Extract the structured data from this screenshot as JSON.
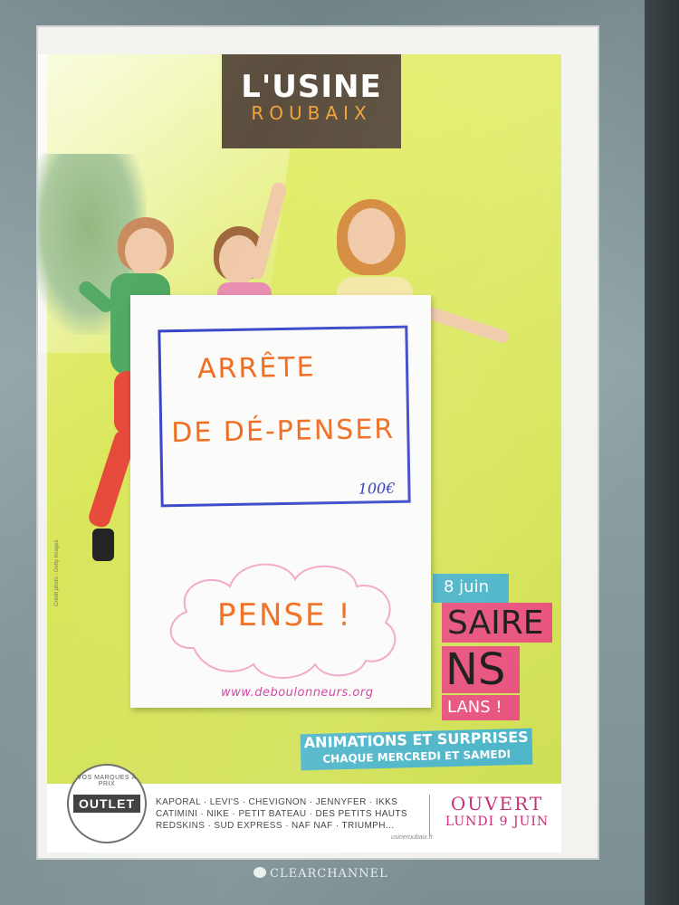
{
  "poster": {
    "logo_main": "L'USINE",
    "logo_sub": "ROUBAIX",
    "photo_credit": "Crédit photo : Getty Images",
    "tags": {
      "date": "8 juin",
      "anniversaire_fragment": "SAIRE",
      "ans_fragment": "NS",
      "ans_line2_fragment": "LANS !",
      "animations": "ANIMATIONS ET SURPRISES",
      "days": "CHAQUE MERCREDI ET SAMEDI"
    },
    "footer": {
      "badge_arc": "VOS MARQUES À PRIX",
      "badge_main": "OUTLET",
      "brands_line1": "KAPORAL · LEVI'S · CHEVIGNON · JENNYFER · IKKS",
      "brands_line2": "CATIMINI · NIKE · PETIT BATEAU · DES PETITS HAUTS",
      "brands_line3": "REDSKINS · SUD EXPRESS · NAF NAF · TRIUMPH...",
      "url": "usineroubaix.fr",
      "ouvert": "OUVERT",
      "date": "LUNDI 9 JUIN"
    }
  },
  "sign": {
    "line1": "ARRÊTE",
    "line2": "DE DÉ-PENSER",
    "price": "100€",
    "pense": "PENSE !",
    "url": "www.deboulonneurs.org"
  },
  "frame": {
    "brand": "CLEARCHANNEL"
  }
}
